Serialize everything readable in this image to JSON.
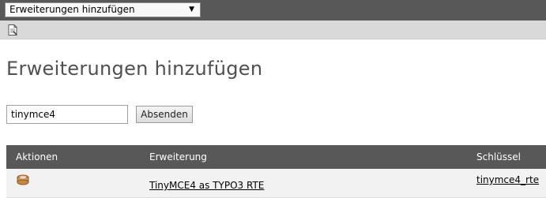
{
  "header": {
    "module_menu": {
      "selected": "Erweiterungen hinzufügen",
      "arrow_icon": "triangle-down-icon"
    }
  },
  "toolbar": {
    "icons": [
      "document-icon"
    ]
  },
  "page": {
    "title": "Erweiterungen hinzufügen"
  },
  "search": {
    "value": "tinymce4",
    "submit_label": "Absenden"
  },
  "results_table": {
    "columns": [
      "Aktionen",
      "Erweiterung",
      "Schlüssel"
    ],
    "rows": [
      {
        "action_icon": "import-extension-icon",
        "extension": "TinyMCE4 as TYPO3 RTE",
        "key": "tinymce4_rte"
      }
    ]
  }
}
